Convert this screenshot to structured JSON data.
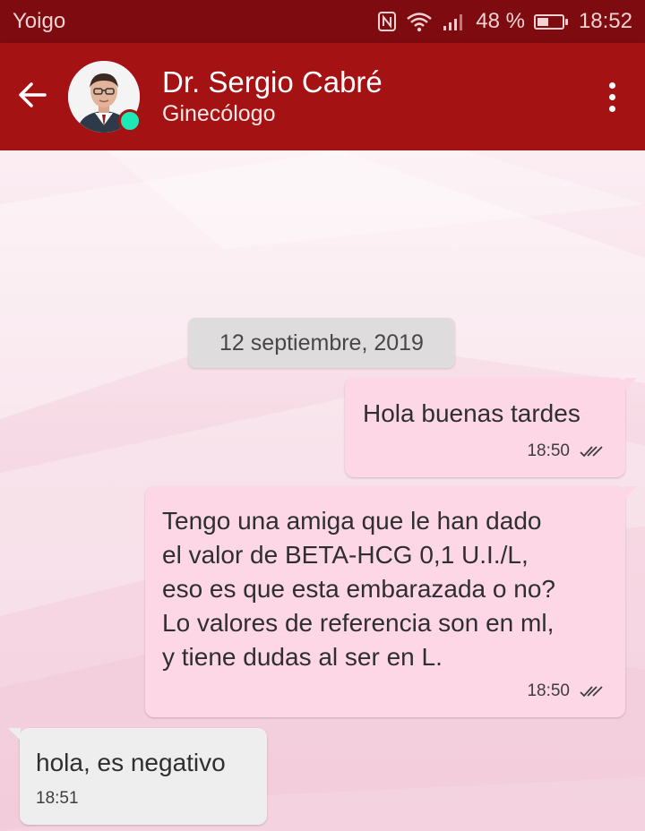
{
  "status_bar": {
    "carrier": "Yoigo",
    "battery_percent": "48 %",
    "battery_level": 0.48,
    "time": "18:52",
    "icons": [
      "nfc-icon",
      "wifi-icon",
      "signal-icon",
      "battery-icon"
    ]
  },
  "app_bar": {
    "contact_name": "Dr. Sergio Cabré",
    "contact_subtitle": "Ginecólogo",
    "online_color": "#1de9b6",
    "bar_color": "#a51213"
  },
  "chat": {
    "date_separator": "12 septiembre, 2019",
    "messages": [
      {
        "direction": "out",
        "text": "Hola buenas tardes",
        "time": "18:50",
        "status": "read"
      },
      {
        "direction": "out",
        "text": "Tengo una amiga que le han dado\nel valor de BETA-HCG 0,1 U.I./L,\neso es que esta embarazada o no?\nLo valores de referencia son en ml,\ny tiene dudas al ser en L.",
        "time": "18:50",
        "status": "read"
      },
      {
        "direction": "in",
        "text": "hola, es negativo",
        "time": "18:51"
      }
    ]
  }
}
